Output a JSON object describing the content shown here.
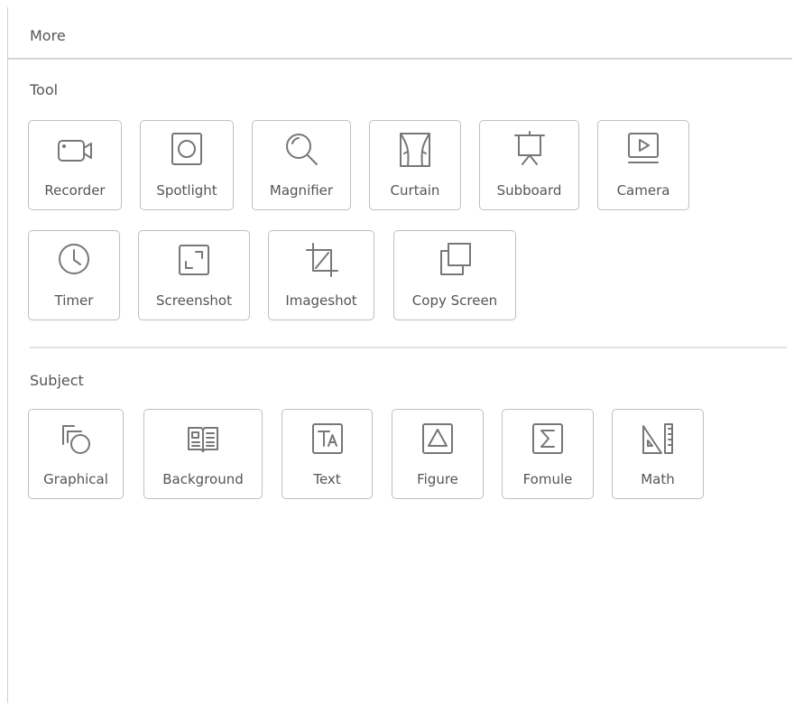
{
  "header": {
    "title": "More"
  },
  "tool_section": {
    "title": "Tool",
    "items": [
      {
        "label": "Recorder",
        "icon": "video-camera-icon"
      },
      {
        "label": "Spotlight",
        "icon": "spotlight-icon"
      },
      {
        "label": "Magnifier",
        "icon": "magnifier-icon"
      },
      {
        "label": "Curtain",
        "icon": "curtain-icon"
      },
      {
        "label": "Subboard",
        "icon": "easel-board-icon"
      },
      {
        "label": "Camera",
        "icon": "monitor-play-icon"
      },
      {
        "label": "Timer",
        "icon": "clock-icon"
      },
      {
        "label": "Screenshot",
        "icon": "screenshot-frame-icon"
      },
      {
        "label": "Imageshot",
        "icon": "crop-icon"
      },
      {
        "label": "Copy Screen",
        "icon": "copy-screen-icon"
      }
    ]
  },
  "subject_section": {
    "title": "Subject",
    "items": [
      {
        "label": "Graphical",
        "icon": "shapes-icon"
      },
      {
        "label": "Background",
        "icon": "open-book-icon"
      },
      {
        "label": "Text",
        "icon": "text-box-icon"
      },
      {
        "label": "Figure",
        "icon": "triangle-figure-icon"
      },
      {
        "label": "Fomule",
        "icon": "sigma-formula-icon"
      },
      {
        "label": "Math",
        "icon": "set-square-ruler-icon"
      }
    ]
  }
}
